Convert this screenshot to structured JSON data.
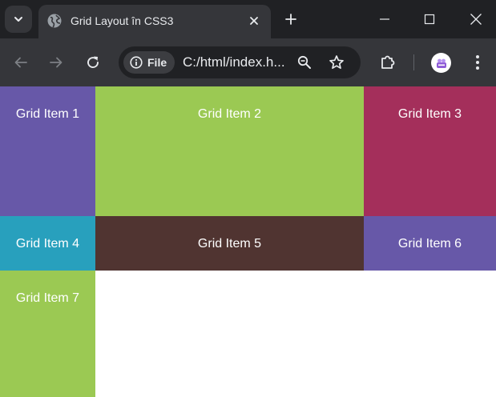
{
  "tab": {
    "title": "Grid Layout în CSS3"
  },
  "address_bar": {
    "site_chip_label": "File",
    "url": "C:/html/index.h..."
  },
  "colors": {
    "tabstrip_bg": "#202124",
    "toolbar_bg": "#35363a"
  },
  "grid_items": [
    {
      "label": "Grid Item 1",
      "color": "#6758a8"
    },
    {
      "label": "Grid Item 2",
      "color": "#9bc953"
    },
    {
      "label": "Grid Item 3",
      "color": "#a42f5b"
    },
    {
      "label": "Grid Item 4",
      "color": "#28a0bd"
    },
    {
      "label": "Grid Item 5",
      "color": "#503431"
    },
    {
      "label": "Grid Item 6",
      "color": "#6758a8"
    },
    {
      "label": "Grid Item 7",
      "color": "#9bc953"
    }
  ],
  "icons": {
    "tab_search": "chevron-down-icon",
    "favicon": "globe-icon",
    "tab_close": "close-icon",
    "new_tab": "plus-icon",
    "minimize": "minimize-icon",
    "maximize": "maximize-icon",
    "close": "close-icon",
    "back": "arrow-left-icon",
    "forward": "arrow-right-icon",
    "reload": "reload-icon",
    "site_info": "info-icon",
    "zoom": "zoom-out-icon",
    "bookmark": "star-icon",
    "extensions": "puzzle-icon",
    "profile": "profile-avatar",
    "menu": "kebab-menu-icon"
  }
}
